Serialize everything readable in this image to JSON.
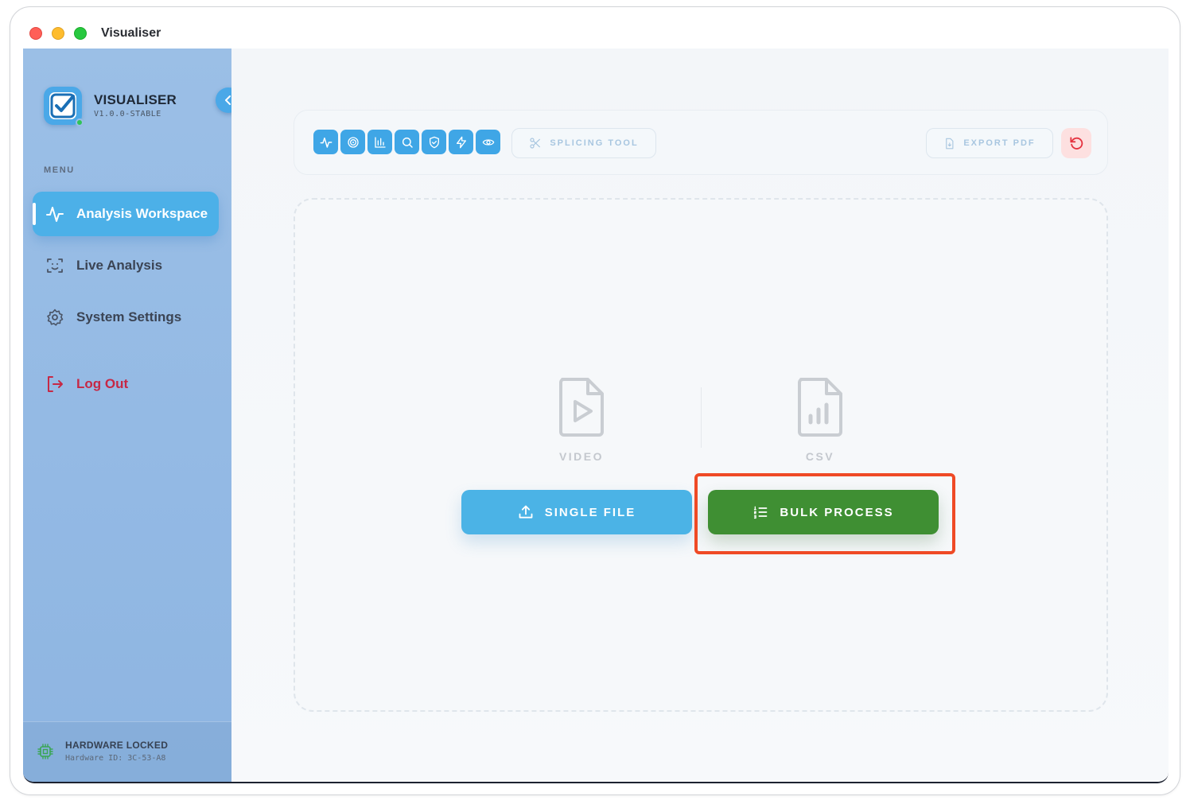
{
  "window": {
    "title": "Visualiser"
  },
  "brand": {
    "name": "VISUALISER",
    "version": "V1.0.0-STABLE"
  },
  "sidebar": {
    "menu_label": "MENU",
    "items": [
      {
        "label": "Analysis Workspace",
        "icon": "activity-icon",
        "active": true
      },
      {
        "label": "Live Analysis",
        "icon": "face-scan-icon",
        "active": false
      },
      {
        "label": "System Settings",
        "icon": "gear-icon",
        "active": false
      }
    ],
    "logout_label": "Log Out",
    "hardware": {
      "title": "HARDWARE LOCKED",
      "id": "Hardware ID: 3C-53-A8"
    }
  },
  "toolbar": {
    "tools_group_1": [
      "activity-icon",
      "target-icon",
      "bar-chart-icon",
      "search-icon"
    ],
    "tools_group_2": [
      "shield-icon",
      "bolt-icon",
      "eye-icon"
    ],
    "splicing_label": "SPLICING TOOL",
    "export_label": "EXPORT PDF"
  },
  "dropzone": {
    "video_label": "VIDEO",
    "csv_label": "CSV",
    "single_file_label": "SINGLE FILE",
    "bulk_process_label": "BULK PROCESS"
  },
  "colors": {
    "accent": "#4bb3e6",
    "bulk_green": "#3f8f33",
    "logout_red": "#c62845",
    "highlight": "#ef4a25"
  }
}
